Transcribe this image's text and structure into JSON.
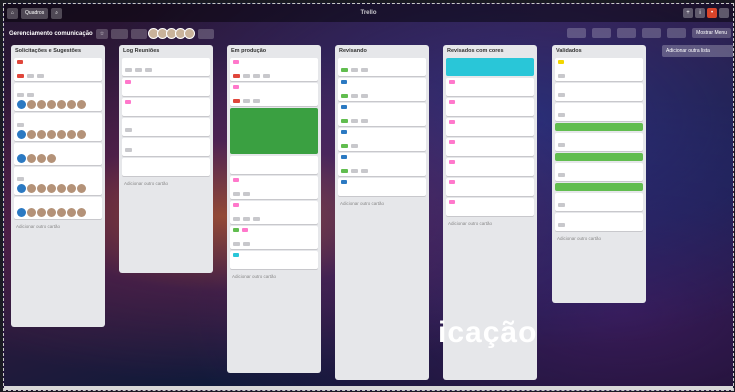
{
  "topbar": {
    "boards_label": "Quadros",
    "logo": "Trello"
  },
  "board": {
    "title": "Gerenciamento comunicação",
    "menu_label": "Mostrar Menu"
  },
  "add_list_label": "Adicionar outra lista",
  "overlay_text": "icação",
  "colors": {
    "green": "#61bd4f",
    "red": "#e0463b",
    "cyan": "#29c6d8",
    "pink": "#ff78cb"
  },
  "lists": [
    {
      "title": "Solicitações e Sugestões",
      "add_label": "Adicionar outro cartão"
    },
    {
      "title": "Log Reuniões",
      "add_label": "Adicionar outro cartão"
    },
    {
      "title": "Em produção",
      "add_label": "Adicionar outro cartão"
    },
    {
      "title": "Revisando",
      "add_label": "Adicionar outro cartão"
    },
    {
      "title": "Revisados com cores",
      "add_label": "Adicionar outro cartão"
    },
    {
      "title": "Validados",
      "add_label": "Adicionar outro cartão"
    }
  ]
}
